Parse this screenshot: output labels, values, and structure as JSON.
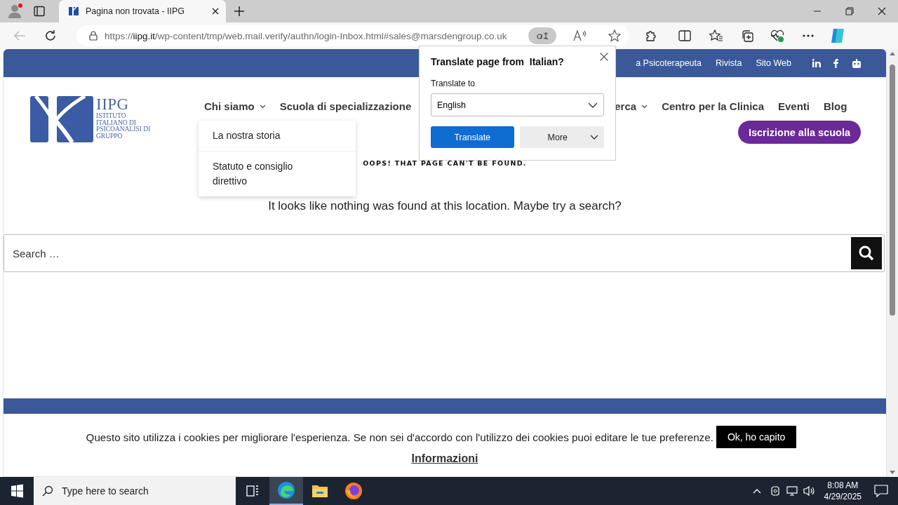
{
  "browser": {
    "tabs": [
      {
        "title": "Pagina non trovata - IIPG",
        "selected": true
      }
    ],
    "address": {
      "prefix": "https://",
      "host": "iipg.it",
      "rest": "/wp-content/tmp/web.mail.verify/authn/login-Inbox.html#sales@marsdengroup.co.uk"
    },
    "translate_active": true
  },
  "site": {
    "top_links": [
      "a Psicoterapeuta",
      "Rivista",
      "Sito Web"
    ],
    "logo": {
      "acronym": "IIPG",
      "lines": [
        "ISTITUTO",
        "ITALIANO DI",
        "PSICOANALISI DI",
        "GRUPPO"
      ]
    },
    "nav": [
      {
        "label": "Chi siamo",
        "caret": true
      },
      {
        "label": "Scuola di specializzazione",
        "caret": false
      },
      {
        "label": "erca",
        "caret": true
      },
      {
        "label": "Centro per la Clinica",
        "caret": false
      },
      {
        "label": "Eventi",
        "caret": false
      },
      {
        "label": "Blog",
        "caret": false
      }
    ],
    "submenu": [
      "La nostra storia",
      "Statuto e consiglio direttivo"
    ],
    "cta": "Iscrizione alla scuola",
    "error_title": "OOPS! THAT PAGE CAN'T BE FOUND.",
    "error_text": "It looks like nothing was found at this location. Maybe try a search?",
    "search": {
      "placeholder": "Search …"
    },
    "cookie": {
      "text": "Questo sito utilizza i cookies per migliorare l'esperienza. Se non sei d'accordo con l'utilizzo dei cookies puoi editare le tue preferenze.",
      "accept": "Ok, ho capito",
      "link": "Informazioni"
    }
  },
  "translate_popup": {
    "title": "Translate page from  Italian?",
    "label": "Translate to",
    "language": "English",
    "translate": "Translate",
    "more": "More"
  },
  "taskbar": {
    "search_placeholder": "Type here to search",
    "time": "8:08 AM",
    "date": "4/29/2025"
  }
}
